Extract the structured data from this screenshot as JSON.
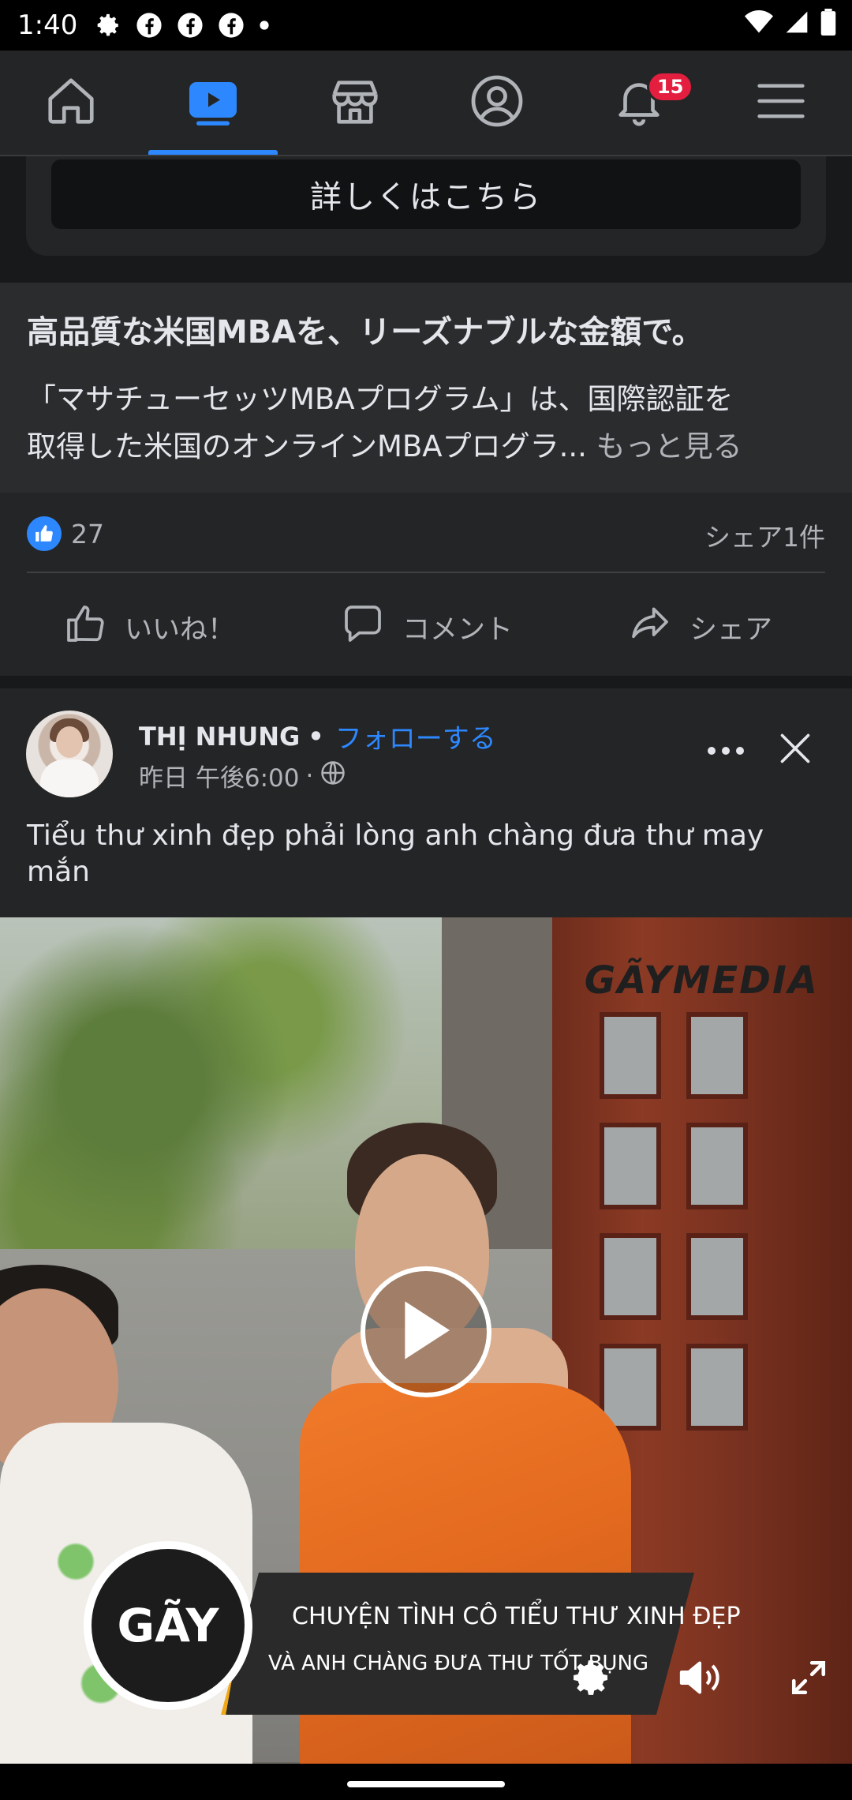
{
  "status_bar": {
    "time": "1:40"
  },
  "nav": {
    "notification_badge": "15",
    "active_tab": "watch"
  },
  "ad_card": {
    "cta_label": "詳しくはこちら",
    "headline": "高品質な米国MBAを、リーズナブルな金額で。",
    "description_line1": "「マサチューセッツMBAプログラム」は、国際認証を",
    "description_line2": "取得した米国のオンラインMBAプログラ...",
    "see_more": "もっと見る"
  },
  "reactions": {
    "like_count": "27",
    "share_count": "シェア1件",
    "like_label": "いいね！",
    "comment_label": "コメント",
    "share_label": "シェア"
  },
  "post": {
    "author": "THỊ NHUNG",
    "separator": "•",
    "follow_label": "フォローする",
    "timestamp": "昨日 午後6:00",
    "meta_separator": "·",
    "caption": "Tiểu thư xinh đẹp phải lòng anh chàng đưa thư may mắn",
    "video": {
      "watermark": "GÃYMEDIA",
      "banner_logo": "GÃY",
      "banner_line1": "CHUYỆN TÌNH CÔ TIỂU THƯ XINH ĐẸP",
      "banner_line2": "VÀ ANH CHÀNG ĐƯA THƯ TỐT BỤNG"
    }
  },
  "colors": {
    "accent": "#2d88ff",
    "badge": "#e41e3f",
    "surface": "#242526",
    "background": "#18191a"
  }
}
